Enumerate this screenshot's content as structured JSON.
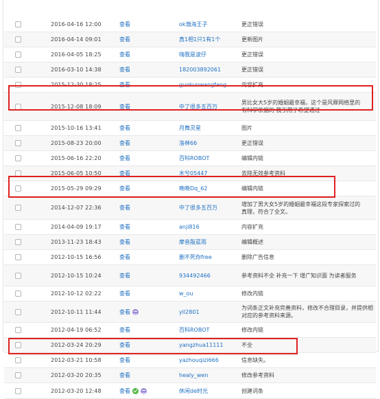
{
  "view_label": "查看",
  "rows": [
    {
      "time": "2016-04-16 12:00",
      "user": "ok渤海王子",
      "reason": "更正错误"
    },
    {
      "time": "2016-04-14 09:01",
      "user": "真1相1只1有1个",
      "reason": "更新图片"
    },
    {
      "time": "2016-04-05 18:25",
      "user": "嗨我是波仔",
      "reason": "更正错误"
    },
    {
      "time": "2016-03-10 14:38",
      "user": "182003892061",
      "reason": "更正错误"
    },
    {
      "time": "2015-12-30 18:25",
      "user": "guokunwangfang",
      "reason": "内容扩充"
    },
    {
      "time": "2015-12-08 18:09",
      "user": "中了很多五百万",
      "reason": "男比女大5岁的婚姻最幸福，这个是风靡网络里的 有科学依据的 我引用了希望通过"
    },
    {
      "time": "2015-10-16 13:41",
      "user": "月舞灵星",
      "reason": "图片"
    },
    {
      "time": "2015-08-23 20:00",
      "user": "洛林66",
      "reason": "更正错误"
    },
    {
      "time": "2015-06-16 22:20",
      "user": "百科ROBOT",
      "reason": "编辑内链"
    },
    {
      "time": "2015-06-05 10:50",
      "user": "木兮05447",
      "reason": "去除无效参考资料"
    },
    {
      "time": "2015-05-29 09:29",
      "user": "晚晚Dq_62",
      "reason": "编辑内链"
    },
    {
      "time": "2014-12-07 22:36",
      "user": "中了很多五百万",
      "reason": "增加了男大女5岁的婚姻最幸福这段专家探索过的真理，符合了全文。"
    },
    {
      "time": "2014-04-09 19:17",
      "user": "anji816",
      "reason": "内容扩充"
    },
    {
      "time": "2013-11-23 18:43",
      "user": "摩音殷蓝雨",
      "reason": "编辑概述"
    },
    {
      "time": "2012-10-15 16:56",
      "user": "删不死你free",
      "reason": "删除广告信息"
    },
    {
      "time": "2012-10-15 10:24",
      "user": "934492466",
      "reason": "参考资料不全 补充一下 增广知识面 为读者服务"
    },
    {
      "time": "2012-10-12 02:22",
      "user": "w_ou",
      "reason": "修改内链"
    },
    {
      "time": "2012-10-11 11:44",
      "user": "yll2801",
      "reason": "为词条正文补充完善资料，修改不合理目录，并提供相对应的参考资料来源。"
    },
    {
      "time": "2012-04-19 06:52",
      "user": "百科ROBOT",
      "reason": "修改内链"
    },
    {
      "time": "2012-03-24 20:29",
      "user": "yangzhua11111",
      "reason": "不全"
    },
    {
      "time": "2012-03-21 10:58",
      "user": "yazhouqizi666",
      "reason": "信息缺失。"
    },
    {
      "time": "2012-03-20 20:35",
      "user": "healy_wen",
      "reason": "修改参考资料"
    },
    {
      "time": "2012-03-20 12:48",
      "user": "休闲de时光",
      "reason": "创建词条"
    }
  ],
  "colors": {
    "link": "#1d6fc2",
    "highlight": "#e02020",
    "badge_purple": "#9e8ed8",
    "badge_green": "#56b84a"
  }
}
